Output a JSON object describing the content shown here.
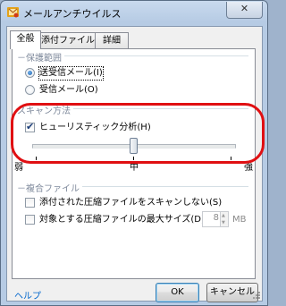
{
  "window": {
    "title": "メールアンチウイルス",
    "close_glyph": "✕"
  },
  "tabs": [
    {
      "label": "全般",
      "active": true
    },
    {
      "label": "添付ファイル",
      "active": false
    },
    {
      "label": "詳細",
      "active": false
    }
  ],
  "protection_scope": {
    "title": "保護範囲",
    "options": [
      {
        "label": "送受信メール(I)",
        "checked": true
      },
      {
        "label": "受信メール(O)",
        "checked": false
      }
    ]
  },
  "scan_method": {
    "title": "スキャン方法",
    "heuristic_label": "ヒューリスティック分析(H)",
    "heuristic_checked": true,
    "slider_level": 0.5,
    "level_labels": [
      "弱",
      "中",
      "強"
    ]
  },
  "compressed_files": {
    "title": "複合ファイル",
    "skip_attachments_label": "添付された圧縮ファイルをスキャンしない(S)",
    "skip_attachments_checked": false,
    "max_size_label": "対象とする圧縮ファイルの最大サイズ(D):",
    "max_size_checked": false,
    "max_size_value": "8",
    "max_size_unit": "MB"
  },
  "footer": {
    "help_label": "ヘルプ",
    "ok_label": "OK",
    "cancel_label": "キャンセル"
  },
  "colors": {
    "annotation_red": "#e00f12",
    "help_link": "#0066cc"
  }
}
